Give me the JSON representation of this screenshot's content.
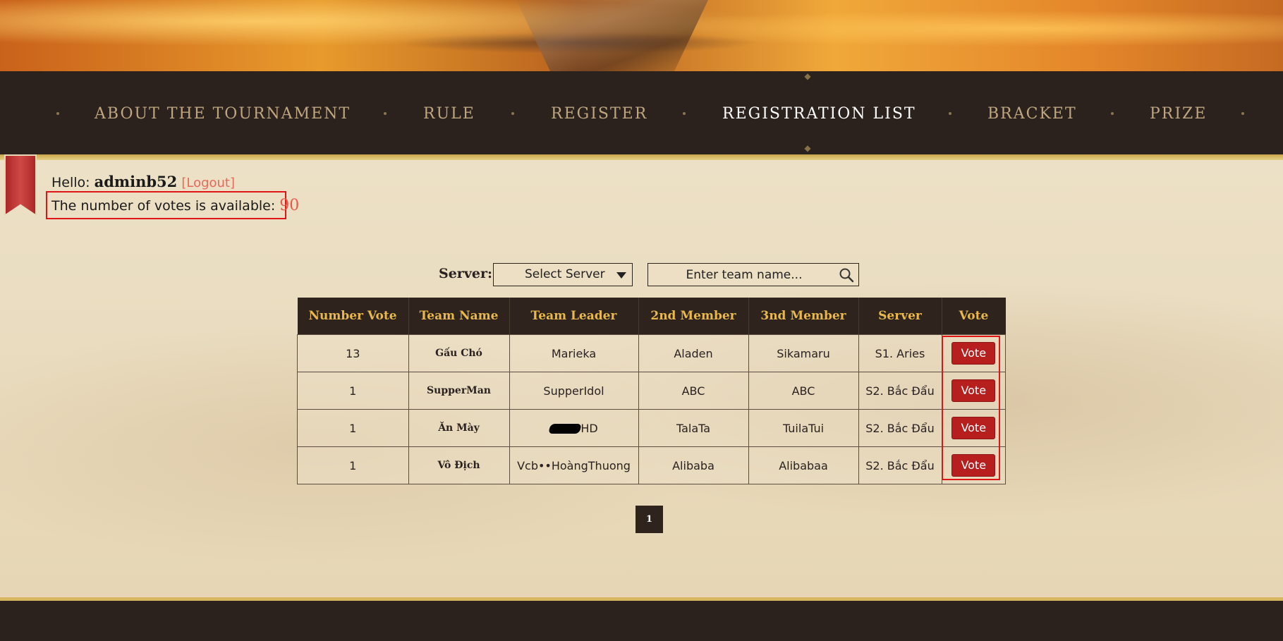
{
  "nav": {
    "items": [
      {
        "label": "ABOUT THE TOURNAMENT",
        "active": false
      },
      {
        "label": "RULE",
        "active": false
      },
      {
        "label": "REGISTER",
        "active": false
      },
      {
        "label": "REGISTRATION LIST",
        "active": true
      },
      {
        "label": "BRACKET",
        "active": false
      },
      {
        "label": "PRIZE",
        "active": false
      }
    ]
  },
  "user": {
    "hello_label": "Hello:",
    "username": "adminb52",
    "logout_label": "[Logout]",
    "votes_label": "The number of votes is available:",
    "votes_available": "90"
  },
  "filter": {
    "server_label": "Server:",
    "server_select_value": "Select Server",
    "team_search_placeholder": "Enter team name..."
  },
  "table": {
    "headers": [
      "Number Vote",
      "Team Name",
      "Team Leader",
      "2nd Member",
      "3nd Member",
      "Server",
      "Vote"
    ],
    "rows": [
      {
        "votes": "13",
        "team": "Gấu Chó",
        "leader": "Marieka",
        "member2": "Aladen",
        "member3": "Sikamaru",
        "server": "S1. Aries",
        "vote_label": "Vote"
      },
      {
        "votes": "1",
        "team": "SupperMan",
        "leader": "SupperIdol",
        "member2": "ABC",
        "member3": "ABC",
        "server": "S2. Bắc Đẩu",
        "vote_label": "Vote"
      },
      {
        "votes": "1",
        "team": "Ăn Mày",
        "leader": "HD",
        "member2": "TalaTa",
        "member3": "TuilaTui",
        "server": "S2. Bắc Đẩu",
        "vote_label": "Vote"
      },
      {
        "votes": "1",
        "team": "Vô Địch",
        "leader": "Vcb••HoàngThuong",
        "member2": "Alibaba",
        "member3": "Alibabaa",
        "server": "S2. Bắc Đẩu",
        "vote_label": "Vote"
      }
    ]
  },
  "pagination": {
    "current_page": "1"
  },
  "colors": {
    "accent": "#e8b84c",
    "vote_button": "#b71f1f",
    "nav_bg": "#2c221d",
    "highlight_box": "#e01616"
  }
}
